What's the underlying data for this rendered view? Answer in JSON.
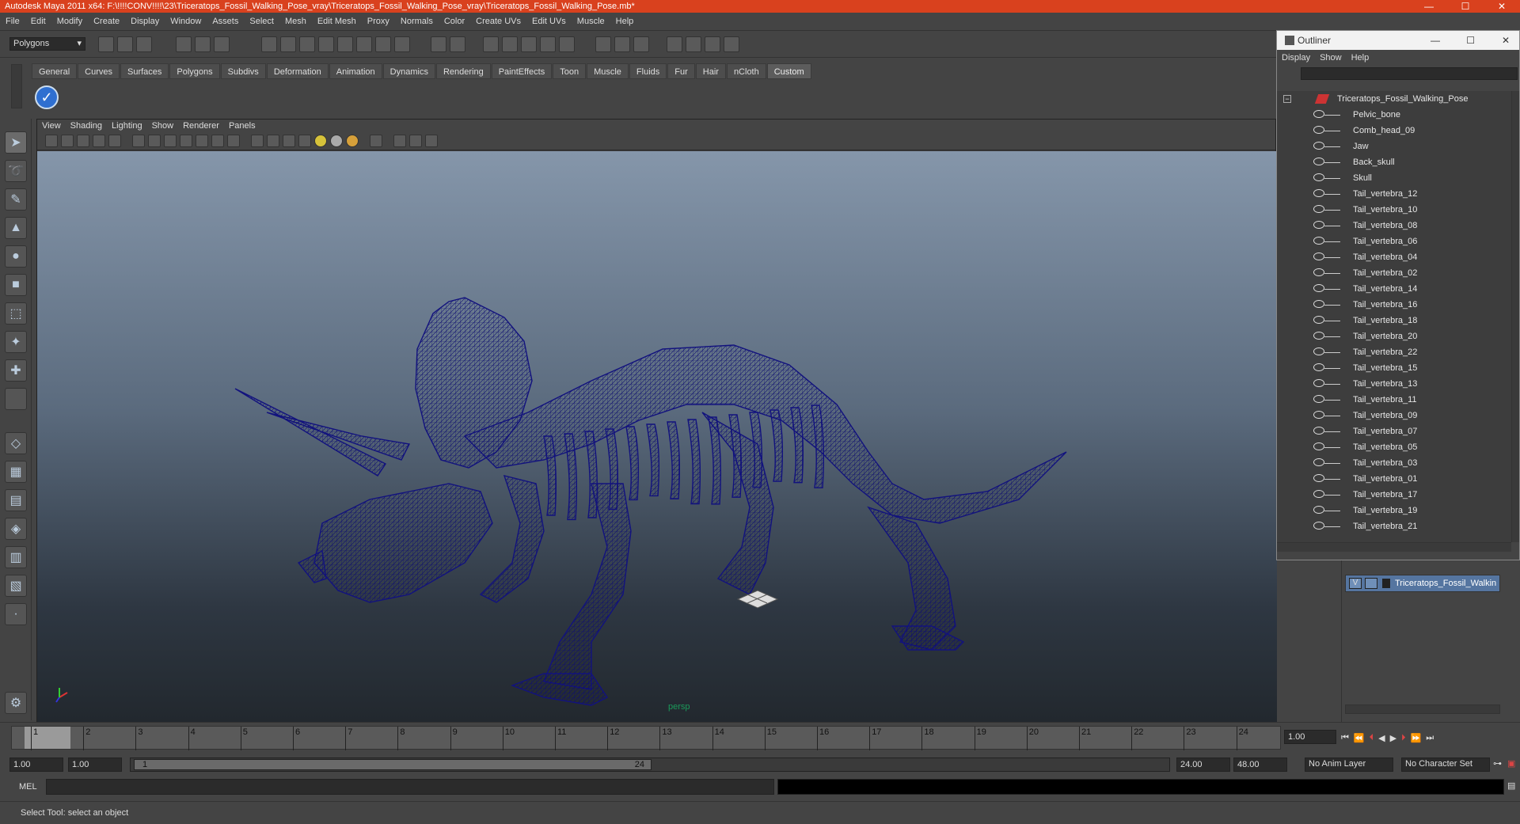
{
  "window": {
    "title": "Autodesk Maya 2011 x64: F:\\!!!!CONV!!!!\\23\\Triceratops_Fossil_Walking_Pose_vray\\Triceratops_Fossil_Walking_Pose_vray\\Triceratops_Fossil_Walking_Pose.mb*",
    "title_color": "#d9411e"
  },
  "menubar": {
    "items": [
      "File",
      "Edit",
      "Modify",
      "Create",
      "Display",
      "Window",
      "Assets",
      "Select",
      "Mesh",
      "Edit Mesh",
      "Proxy",
      "Normals",
      "Color",
      "Create UVs",
      "Edit UVs",
      "Muscle",
      "Help"
    ]
  },
  "statusline": {
    "mode": "Polygons"
  },
  "shelf": {
    "tabs": [
      "General",
      "Curves",
      "Surfaces",
      "Polygons",
      "Subdivs",
      "Deformation",
      "Animation",
      "Dynamics",
      "Rendering",
      "PaintEffects",
      "Toon",
      "Muscle",
      "Fluids",
      "Fur",
      "Hair",
      "nCloth",
      "Custom"
    ],
    "active_tab": "Custom"
  },
  "viewport": {
    "menu": [
      "View",
      "Shading",
      "Lighting",
      "Show",
      "Renderer",
      "Panels"
    ],
    "camera_label": "persp",
    "wireframe_color": "#1a1a8a"
  },
  "outliner": {
    "title": "Outliner",
    "menu": [
      "Display",
      "Show",
      "Help"
    ],
    "root": "Triceratops_Fossil_Walking_Pose",
    "items": [
      "Pelvic_bone",
      "Comb_head_09",
      "Jaw",
      "Back_skull",
      "Skull",
      "Tail_vertebra_12",
      "Tail_vertebra_10",
      "Tail_vertebra_08",
      "Tail_vertebra_06",
      "Tail_vertebra_04",
      "Tail_vertebra_02",
      "Tail_vertebra_14",
      "Tail_vertebra_16",
      "Tail_vertebra_18",
      "Tail_vertebra_20",
      "Tail_vertebra_22",
      "Tail_vertebra_15",
      "Tail_vertebra_13",
      "Tail_vertebra_11",
      "Tail_vertebra_09",
      "Tail_vertebra_07",
      "Tail_vertebra_05",
      "Tail_vertebra_03",
      "Tail_vertebra_01",
      "Tail_vertebra_17",
      "Tail_vertebra_19",
      "Tail_vertebra_21"
    ]
  },
  "layers": {
    "visibility": "V",
    "layer_name": "Triceratops_Fossil_Walkin"
  },
  "timeslider": {
    "ticks": [
      "1",
      "2",
      "3",
      "4",
      "5",
      "6",
      "7",
      "8",
      "9",
      "10",
      "11",
      "12",
      "13",
      "14",
      "15",
      "16",
      "17",
      "18",
      "19",
      "20",
      "21",
      "22",
      "23",
      "24"
    ],
    "current_frame": "1.00"
  },
  "range": {
    "start": "1.00",
    "playback_start": "1.00",
    "range_start_label": "1",
    "range_end_label": "24",
    "playback_end": "24.00",
    "end": "48.00",
    "anim_layer": "No Anim Layer",
    "character_set": "No Character Set"
  },
  "command": {
    "label": "MEL"
  },
  "help": {
    "text": "Select Tool: select an object"
  }
}
